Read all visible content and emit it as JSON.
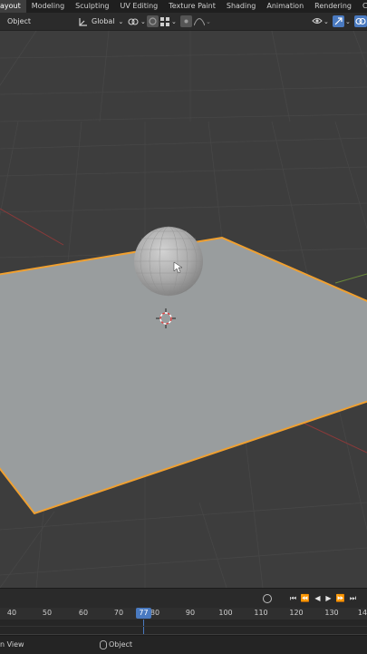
{
  "workspace_tabs": [
    "ayout",
    "Modeling",
    "Sculpting",
    "UV Editing",
    "Texture Paint",
    "Shading",
    "Animation",
    "Rendering",
    "Compositing"
  ],
  "header": {
    "mode": "Object",
    "transform_orientation": "Global",
    "icons": [
      "orientation-icon",
      "pivot-icon",
      "snap-icon",
      "snap-increment-icon",
      "proportional-edit-icon",
      "falloff-icon",
      "visibility-icon",
      "gizmo-icon",
      "overlay-icon"
    ]
  },
  "timeline": {
    "ticks": [
      "40",
      "50",
      "60",
      "70",
      "80",
      "90",
      "100",
      "110",
      "120",
      "130",
      "14"
    ],
    "current_frame": "77"
  },
  "status_bar": {
    "left": "n View",
    "middle": "Object"
  },
  "colors": {
    "selection_outline": "#f0a030",
    "current_frame": "#4a7ac0",
    "viewport_bg": "#3d3d3d"
  }
}
